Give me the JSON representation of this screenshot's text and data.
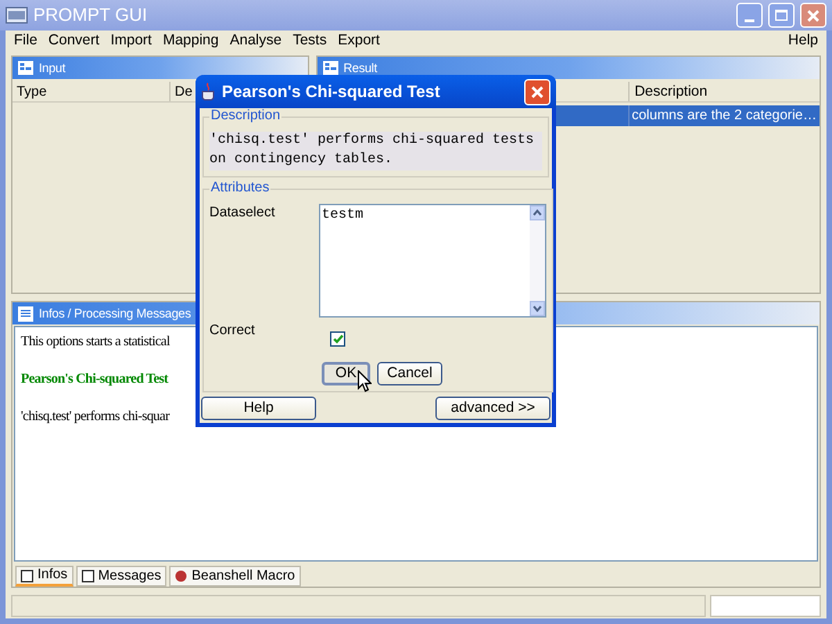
{
  "window": {
    "title": "PROMPT GUI"
  },
  "menu": [
    {
      "label": "File"
    },
    {
      "label": "Convert"
    },
    {
      "label": "Import"
    },
    {
      "label": "Mapping"
    },
    {
      "label": "Analyse"
    },
    {
      "label": "Tests"
    },
    {
      "label": "Export"
    }
  ],
  "help_menu": {
    "label": "Help"
  },
  "input_panel": {
    "title": "Input",
    "columns": [
      "Type",
      "De"
    ]
  },
  "result_panel": {
    "title": "Result",
    "columns": [
      "Description"
    ],
    "rows": [
      {
        "selected": true,
        "cells": [
          "columns are the 2 categorie…"
        ]
      }
    ]
  },
  "info_panel": {
    "title": "Infos / Processing Messages",
    "lines": [
      {
        "kind": "text",
        "text": "This options starts a statistical"
      },
      {
        "kind": "heading",
        "text": "Pearson's Chi-squared Test"
      },
      {
        "kind": "text",
        "text": "'chisq.test' performs chi-squar"
      }
    ],
    "tabs": [
      {
        "label": "Infos",
        "selected": true
      },
      {
        "label": "Messages",
        "selected": false
      },
      {
        "label": "Beanshell Macro",
        "selected": false
      }
    ]
  },
  "dialog": {
    "title": "Pearson's Chi-squared Test",
    "description_label": "Description",
    "description": "'chisq.test' performs chi-squared tests on contingency tables.",
    "attributes_label": "Attributes",
    "fields": [
      {
        "kind": "textarea",
        "label": "Dataselect",
        "value": "testm"
      },
      {
        "kind": "checkbox",
        "label": "Correct",
        "checked": true
      }
    ],
    "buttons": [
      {
        "label": "OK",
        "focused": true
      },
      {
        "label": "Cancel",
        "focused": false
      }
    ],
    "footer_buttons": [
      "Help",
      "advanced >>"
    ]
  }
}
